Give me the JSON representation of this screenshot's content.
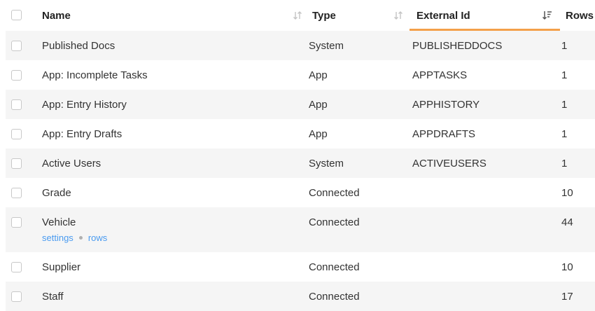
{
  "header": {
    "name_label": "Name",
    "type_label": "Type",
    "external_id_label": "External Id",
    "rows_label": "Rows",
    "sort_icon_name": "sort-icon",
    "active_sort_icon_name": "sort-descending-icon",
    "active_underline_color": "#f4a04a"
  },
  "rows": [
    {
      "name": "Published Docs",
      "type": "System",
      "external_id": "PUBLISHEDDOCS",
      "rows": "1"
    },
    {
      "name": "App: Incomplete Tasks",
      "type": "App",
      "external_id": "APPTASKS",
      "rows": "1"
    },
    {
      "name": "App: Entry History",
      "type": "App",
      "external_id": "APPHISTORY",
      "rows": "1"
    },
    {
      "name": "App: Entry Drafts",
      "type": "App",
      "external_id": "APPDRAFTS",
      "rows": "1"
    },
    {
      "name": "Active Users",
      "type": "System",
      "external_id": "ACTIVEUSERS",
      "rows": "1"
    },
    {
      "name": "Grade",
      "type": "Connected",
      "external_id": "",
      "rows": "10"
    },
    {
      "name": "Vehicle",
      "type": "Connected",
      "external_id": "",
      "rows": "44",
      "links": [
        "settings",
        "rows"
      ]
    },
    {
      "name": "Supplier",
      "type": "Connected",
      "external_id": "",
      "rows": "10"
    },
    {
      "name": "Staff",
      "type": "Connected",
      "external_id": "",
      "rows": "17"
    }
  ],
  "colors": {
    "stripe": "#f5f5f5",
    "link": "#4a9bf0"
  }
}
